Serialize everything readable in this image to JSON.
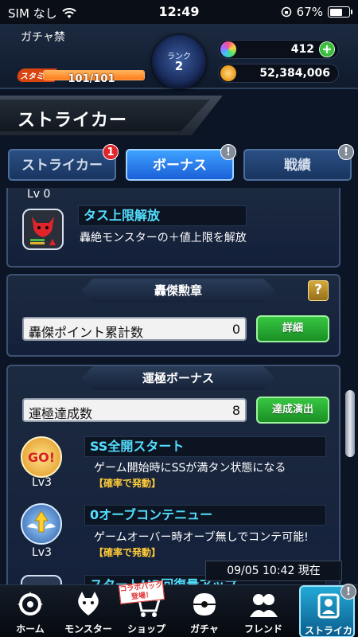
{
  "status": {
    "carrier": "SIM なし",
    "time": "12:49",
    "battery": "67%",
    "battery_level": 0.67
  },
  "header": {
    "player_title": "ガチャ禁",
    "stamina_label": "スタミナ",
    "stamina_text": "101/101",
    "stamina_level": 1.0,
    "rank_label": "ランク",
    "rank_value": "2",
    "orbs": "412",
    "gold": "52,384,006"
  },
  "page_title": "ストライカー",
  "tabs": [
    {
      "label": "ストライカー",
      "badge": "1",
      "badge_color": "#e0252c",
      "selected": false
    },
    {
      "label": "ボーナス",
      "badge": "!",
      "badge_color": "#828b98",
      "selected": true
    },
    {
      "label": "戦績",
      "badge": "!",
      "badge_color": "#828b98",
      "selected": false
    }
  ],
  "top_level": "Lv 0",
  "tasu_bonus": {
    "name": "タス上限解放",
    "desc": "轟絶モンスターの＋値上限を解放"
  },
  "gouketsu": {
    "heading": "轟傑勲章",
    "help": "?",
    "stat_label": "轟傑ポイント累計数",
    "stat_value": "0",
    "button": "詳細"
  },
  "unkiwa": {
    "heading": "運極ボーナス",
    "stat_label": "運極達成数",
    "stat_value": "8",
    "button": "達成演出"
  },
  "bonuses": [
    {
      "name": "SS全開スタート",
      "desc": "ゲーム開始時にSSが満タン状態になる",
      "chance": "【確率で発動】",
      "level": "Lv3",
      "icon": "go-icon"
    },
    {
      "name": "0オーブコンテニュー",
      "desc": "ゲームオーバー時オーブ無しでコンテ可能!",
      "chance": "【確率で発動】",
      "level": "Lv3",
      "icon": "winged-arrow-icon"
    },
    {
      "name": "スタートHP回復量アップ",
      "level": "",
      "icon": "hp-icon"
    }
  ],
  "timestamp": "09/05 10:42 現在",
  "nav": [
    {
      "label": "ホーム",
      "icon": "home-icon"
    },
    {
      "label": "モンスター",
      "icon": "monster-icon"
    },
    {
      "label": "ショップ",
      "icon": "shop-icon"
    },
    {
      "label": "ガチャ",
      "icon": "gacha-icon"
    },
    {
      "label": "フレンド",
      "icon": "friend-icon"
    },
    {
      "label": "ストライカー",
      "icon": "striker-icon"
    }
  ],
  "collab_tag": "コラボパック登場！",
  "colors": {
    "accent_blue": "#3fa2ff",
    "cyan_text": "#53dfff",
    "green_button": "#38c743",
    "badge_red": "#e0252c"
  }
}
